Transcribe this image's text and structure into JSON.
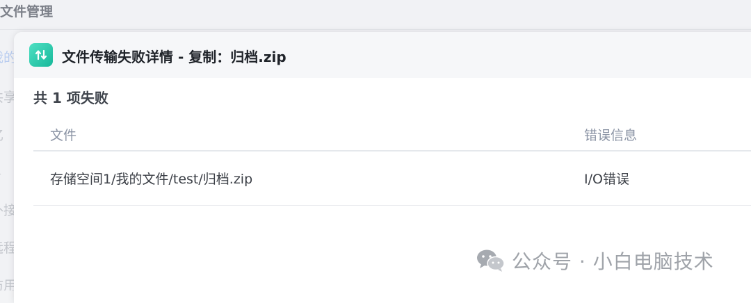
{
  "background": {
    "title": "文件管理",
    "sidebar_items": [
      "我的",
      "共享",
      "忆",
      "ℜ",
      "外接",
      "远程",
      "访用"
    ]
  },
  "dialog": {
    "title": "文件传输失败详情 - 复制：归档.zip",
    "app_icon": "transfer-arrows-icon",
    "summary": "共 1 项失败",
    "columns": {
      "file": "文件",
      "error": "错误信息"
    },
    "rows": [
      {
        "file": "存储空间1/我的文件/test/归档.zip",
        "error": "I/O错误"
      }
    ]
  },
  "watermark": {
    "icon": "wechat-icon",
    "text": "公众号 · 小白电脑技术"
  },
  "colors": {
    "accent_green": "#1fbf9f",
    "header_bg": "#f6f7f9",
    "column_header_text": "#8a93a4"
  }
}
